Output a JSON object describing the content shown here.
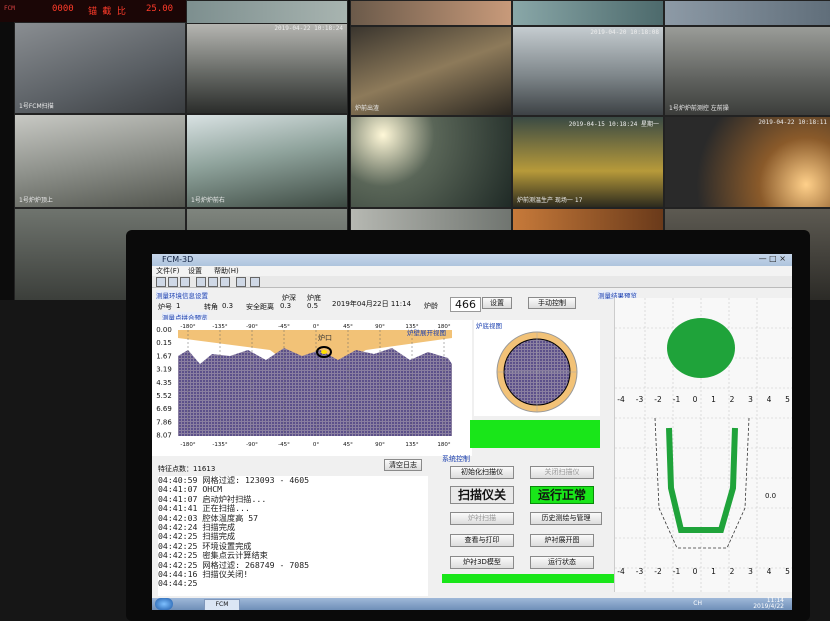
{
  "video_wall": {
    "panel": {
      "left_text": "FCM",
      "mid_label": "锚 截 比",
      "value": "25.00",
      "status": "0000"
    },
    "cameras": [
      {
        "ts": "",
        "label": "1号FCM扫描"
      },
      {
        "ts": "2019-04-22 10:18:24",
        "label": ""
      },
      {
        "ts": "",
        "label": ""
      },
      {
        "ts": "2019-04-20 10:18:08",
        "label": ""
      },
      {
        "ts": "",
        "label": "1号炉炉前测控 左前操"
      },
      {
        "ts": "",
        "label": ""
      },
      {
        "ts": "2019-04-22 10:18:24",
        "label": "炉前出渣"
      },
      {
        "ts": "2019-04-20 10:18:36",
        "label": ""
      },
      {
        "ts": "",
        "label": "1号炉炉顶上"
      },
      {
        "ts": "",
        "label": "1号炉炉前右"
      },
      {
        "ts": "",
        "label": ""
      },
      {
        "ts": "2019-04-22 10:18:11",
        "label": ""
      },
      {
        "ts": "2019-04-15 10:18:24 星期一",
        "label": "炉前测温生产 现场一 17"
      },
      {
        "ts": "",
        "label": ""
      }
    ]
  },
  "window": {
    "title": "FCM-3D",
    "controls": "— □ ×"
  },
  "menu": [
    "文件(F)",
    "设置",
    "帮助(H)"
  ],
  "header": {
    "section_title": "测量环境信息设置",
    "furnace_label": "炉号",
    "furnace_value": "1",
    "angle_label": "转角",
    "angle_value": "0.3",
    "safety_label": "安全距离",
    "safety_value": "0.3",
    "furnace_depth_label": "炉深",
    "furnace_depth_value": "0.5",
    "furnace_diam_label": "炉底",
    "furnace_diam_value": "",
    "datetime": "2019年04月22日 11:14",
    "age_label": "炉龄",
    "age_value": "466",
    "set_button": "设置",
    "manual_button": "手动控制",
    "result_title": "测量结果预览"
  },
  "scan_section": {
    "title": "测量点拼合预览",
    "unfold_title": "炉壁展开视图",
    "bottom_title": "炉底视图",
    "top_angles": [
      "-180°",
      "-135°",
      "-90°",
      "-45°",
      "0°",
      "45°",
      "90°",
      "135°",
      "180°"
    ],
    "bottom_angles": [
      "-180°",
      "-135°",
      "-90°",
      "-45°",
      "0°",
      "45°",
      "90°",
      "135°",
      "180°"
    ],
    "depths": [
      "0.00",
      "0.15",
      "1.67",
      "3.19",
      "4.35",
      "5.52",
      "6.69",
      "7.86",
      "8.07"
    ],
    "marker": "炉口",
    "points_label": "特征点数：11613",
    "clear_button": "清空日志"
  },
  "log": [
    "04:40:59 网格过滤: 123093 - 4605",
    "04:41:07 OHCM",
    "04:41:07 启动炉衬扫描...",
    "04:41:41 正在扫描...",
    "04:42:03 腔体温度高 57",
    "04:42:24 扫描完成",
    "04:42:25 扫描完成",
    "04:42:25 环境设置完成",
    "04:42:25 密集点云计算结束",
    "04:42:25 网格过滤: 268749 - 7085",
    "04:44:16 扫描仪关闭!",
    "04:44:25"
  ],
  "system_control": {
    "title": "系统控制",
    "init_button": "初始化扫描仪",
    "close_scanner_button": "关闭扫描仪",
    "scanner_status": "扫描仪关",
    "run_status": "运行正常",
    "scan_button": "炉衬扫描",
    "history_button": "历史测绘与管理",
    "print_button": "查看与打印",
    "unfold_button": "炉衬展开图",
    "model_button": "炉衬3D模型",
    "status_button": "运行状态",
    "status_color": "#19e619"
  },
  "result_panel": {
    "x_ticks_top": [
      "-4",
      "-3",
      "-2",
      "-1",
      "0",
      "1",
      "2",
      "3",
      "4",
      "5"
    ],
    "x_ticks_bottom": [
      "-4",
      "-3",
      "-2",
      "-1",
      "0",
      "1",
      "2",
      "3",
      "4",
      "5"
    ],
    "right_value": "0.0"
  },
  "taskbar": {
    "app_label": "FCM",
    "ime": "CH",
    "time": "11:14",
    "date": "2019/4/22"
  }
}
